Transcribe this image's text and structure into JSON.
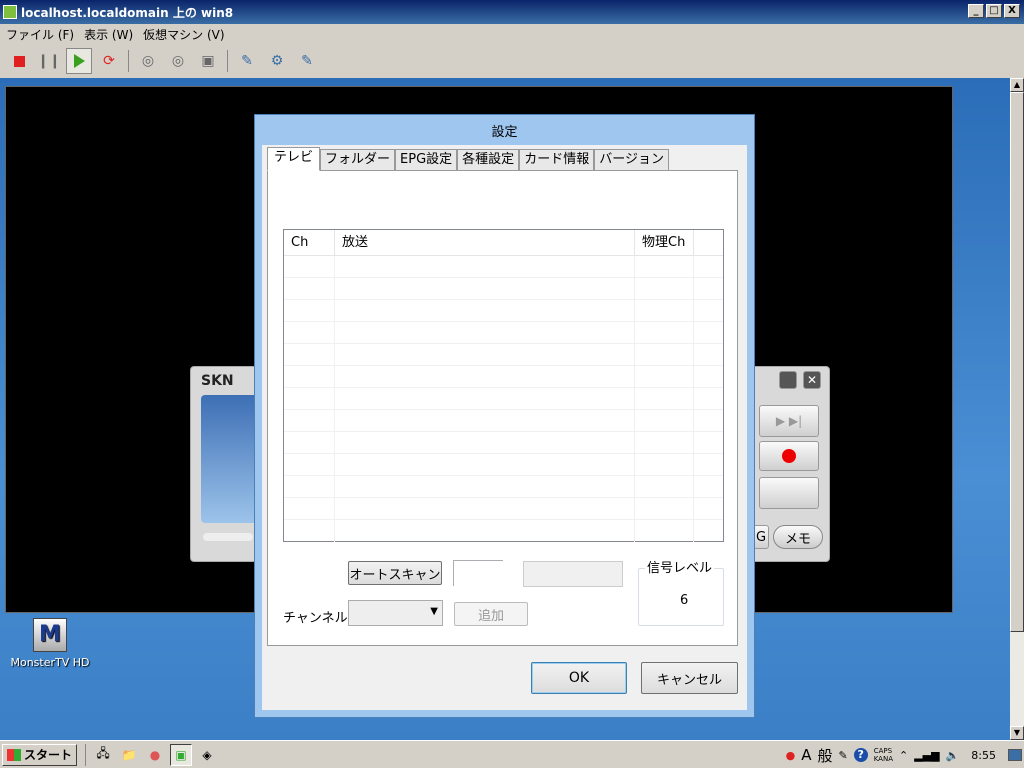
{
  "window": {
    "title": "localhost.localdomain 上の win8",
    "min": "_",
    "max": "□",
    "close": "X"
  },
  "menu": [
    "ファイル (F)",
    "表示 (W)",
    "仮想マシン (V)"
  ],
  "desktop_icon": {
    "label": "MonsterTV HD",
    "glyph": "M"
  },
  "skn": {
    "logo": "SKN",
    "memo": "メモ",
    "partial_label": "G"
  },
  "dialog": {
    "title": "設定",
    "tabs": [
      "テレビ",
      "フォルダー",
      "EPG設定",
      "各種設定",
      "カード情報",
      "バージョン"
    ],
    "columns": [
      "Ch",
      "放送",
      "物理Ch"
    ],
    "auto_scan": "オートスキャン",
    "signal_label": "信号レベル",
    "signal_value": "6",
    "channel_label": "チャンネル",
    "add": "追加",
    "ok": "OK",
    "cancel": "キャンセル"
  },
  "taskbar": {
    "start": "スタート",
    "ime_a": "A",
    "ime_mode": "般",
    "caps": "CAPS",
    "kana": "KANA",
    "help": "?",
    "clock": "8:55"
  }
}
